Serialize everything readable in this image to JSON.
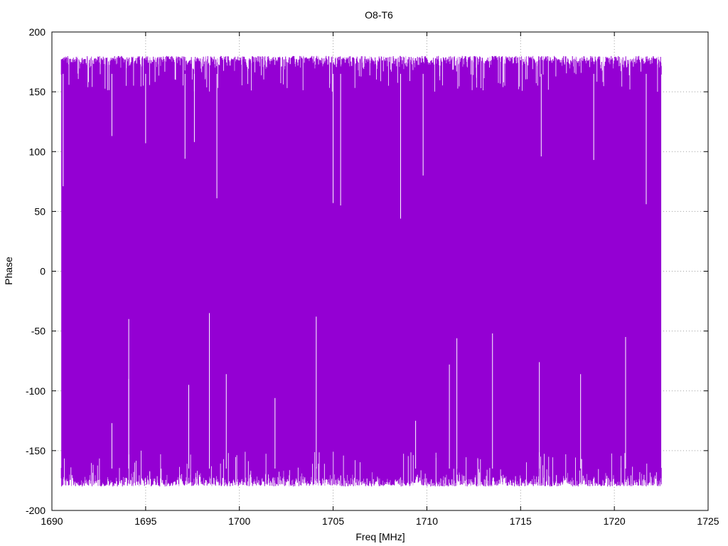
{
  "chart_data": {
    "type": "line",
    "title": "O8-T6",
    "xlabel": "Freq [MHz]",
    "ylabel": "Phase",
    "xlim": [
      1690,
      1725
    ],
    "ylim": [
      -200,
      200
    ],
    "xticks": [
      1690,
      1695,
      1700,
      1705,
      1710,
      1715,
      1720,
      1725
    ],
    "yticks": [
      -200,
      -150,
      -100,
      -50,
      0,
      50,
      100,
      150,
      200
    ],
    "grid": true,
    "legend": "none",
    "series": [
      {
        "color": "#9400d3",
        "x_range": [
          1690.5,
          1722.5
        ],
        "y_min": -180,
        "y_max": 180,
        "description_values": {
          "typical_upper_envelope": [
            165,
            180
          ],
          "typical_lower_envelope": [
            -180,
            -165
          ]
        },
        "notable_spikes": [
          {
            "x": 1690.6,
            "y": 71
          },
          {
            "x": 1693.2,
            "y": 113
          },
          {
            "x": 1695.0,
            "y": 107
          },
          {
            "x": 1697.1,
            "y": 94
          },
          {
            "x": 1697.6,
            "y": 108
          },
          {
            "x": 1698.8,
            "y": 61
          },
          {
            "x": 1705.0,
            "y": 57
          },
          {
            "x": 1705.4,
            "y": 55
          },
          {
            "x": 1708.6,
            "y": 44
          },
          {
            "x": 1709.8,
            "y": 80
          },
          {
            "x": 1716.1,
            "y": 96
          },
          {
            "x": 1718.9,
            "y": 93
          },
          {
            "x": 1721.7,
            "y": 56
          },
          {
            "x": 1694.1,
            "y": -40
          },
          {
            "x": 1694.1,
            "y": -90
          },
          {
            "x": 1697.3,
            "y": -95
          },
          {
            "x": 1698.4,
            "y": -35
          },
          {
            "x": 1699.3,
            "y": -86
          },
          {
            "x": 1704.1,
            "y": -38
          },
          {
            "x": 1701.9,
            "y": -106
          },
          {
            "x": 1711.6,
            "y": -56
          },
          {
            "x": 1711.2,
            "y": -78
          },
          {
            "x": 1713.5,
            "y": -52
          },
          {
            "x": 1716.0,
            "y": -76
          },
          {
            "x": 1718.2,
            "y": -86
          },
          {
            "x": 1720.6,
            "y": -55
          },
          {
            "x": 1693.2,
            "y": -127
          },
          {
            "x": 1709.4,
            "y": -125
          }
        ]
      }
    ]
  }
}
